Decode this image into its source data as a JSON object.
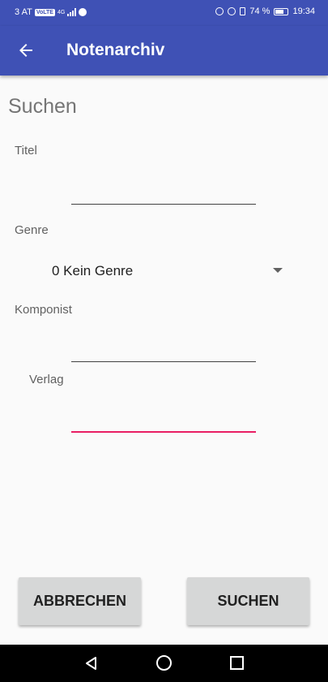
{
  "status_bar": {
    "carrier": "3 AT",
    "network_badge": "VoLTE",
    "network_type": "4G",
    "battery": "74 %",
    "time": "19:34",
    "icons": [
      "signal-icon",
      "spotify-icon",
      "headphones-icon",
      "alarm-icon",
      "vibrate-icon",
      "battery-icon"
    ]
  },
  "app_bar": {
    "title": "Notenarchiv",
    "back_icon": "arrow-left-icon",
    "color": "#3f51b5"
  },
  "form": {
    "heading": "Suchen",
    "titel": {
      "label": "Titel",
      "value": ""
    },
    "genre": {
      "label": "Genre",
      "selected": "0 Kein Genre"
    },
    "komponist": {
      "label": "Komponist",
      "value": ""
    },
    "verlag": {
      "label": "Verlag",
      "value": ""
    }
  },
  "buttons": {
    "cancel": "ABBRECHEN",
    "search": "SUCHEN"
  },
  "nav_bar": {
    "icons": [
      "nav-back-icon",
      "nav-home-icon",
      "nav-recents-icon"
    ]
  },
  "colors": {
    "primary": "#3f51b5",
    "accent": "#e91e63",
    "button_bg": "#d6d7d7"
  }
}
